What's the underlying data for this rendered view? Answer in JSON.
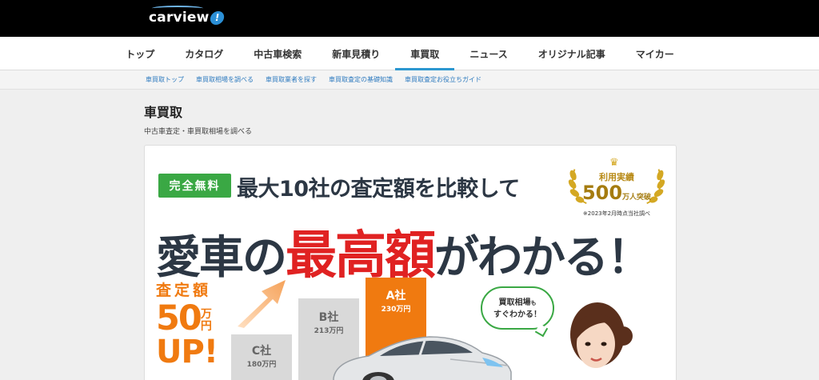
{
  "header": {
    "logo_text": "carview",
    "logo_badge": "!"
  },
  "nav": {
    "items": [
      {
        "label": "トップ"
      },
      {
        "label": "カタログ"
      },
      {
        "label": "中古車検索"
      },
      {
        "label": "新車見積り"
      },
      {
        "label": "車買取",
        "active": true
      },
      {
        "label": "ニュース"
      },
      {
        "label": "オリジナル記事"
      },
      {
        "label": "マイカー"
      }
    ]
  },
  "subnav": {
    "items": [
      {
        "label": "車買取トップ"
      },
      {
        "label": "車買取相場を調べる"
      },
      {
        "label": "車買取業者を探す"
      },
      {
        "label": "車買取査定の基礎知識"
      },
      {
        "label": "車買取査定お役立ちガイド"
      }
    ]
  },
  "page": {
    "title": "車買取",
    "subtitle": "中古車査定・車買取相場を調べる"
  },
  "banner": {
    "free_badge": "完全無料",
    "headline1": "最大10社の査定額を比較して",
    "headline2_a": "愛車の",
    "headline2_b": "最高額",
    "headline2_c": "がわかる！",
    "award": {
      "label": "利用実績",
      "number": "500",
      "unit": "万人突破",
      "note": "※2023年2月時点当社調べ"
    },
    "satei": {
      "label": "査定額",
      "amount": "50",
      "amount_unit": "万円",
      "up": "UP!"
    },
    "bars": [
      {
        "name": "C社",
        "value": "180万円"
      },
      {
        "name": "B社",
        "value": "213万円"
      },
      {
        "name": "A社",
        "value": "230万円"
      }
    ],
    "bubble": {
      "line1": "買取相場",
      "line1_small": "も",
      "line2": "すぐわかる！"
    }
  },
  "colors": {
    "accent_blue": "#2c97d0",
    "green": "#3aa844",
    "orange": "#f07a10",
    "red": "#e02222",
    "gold": "#d4a823"
  }
}
